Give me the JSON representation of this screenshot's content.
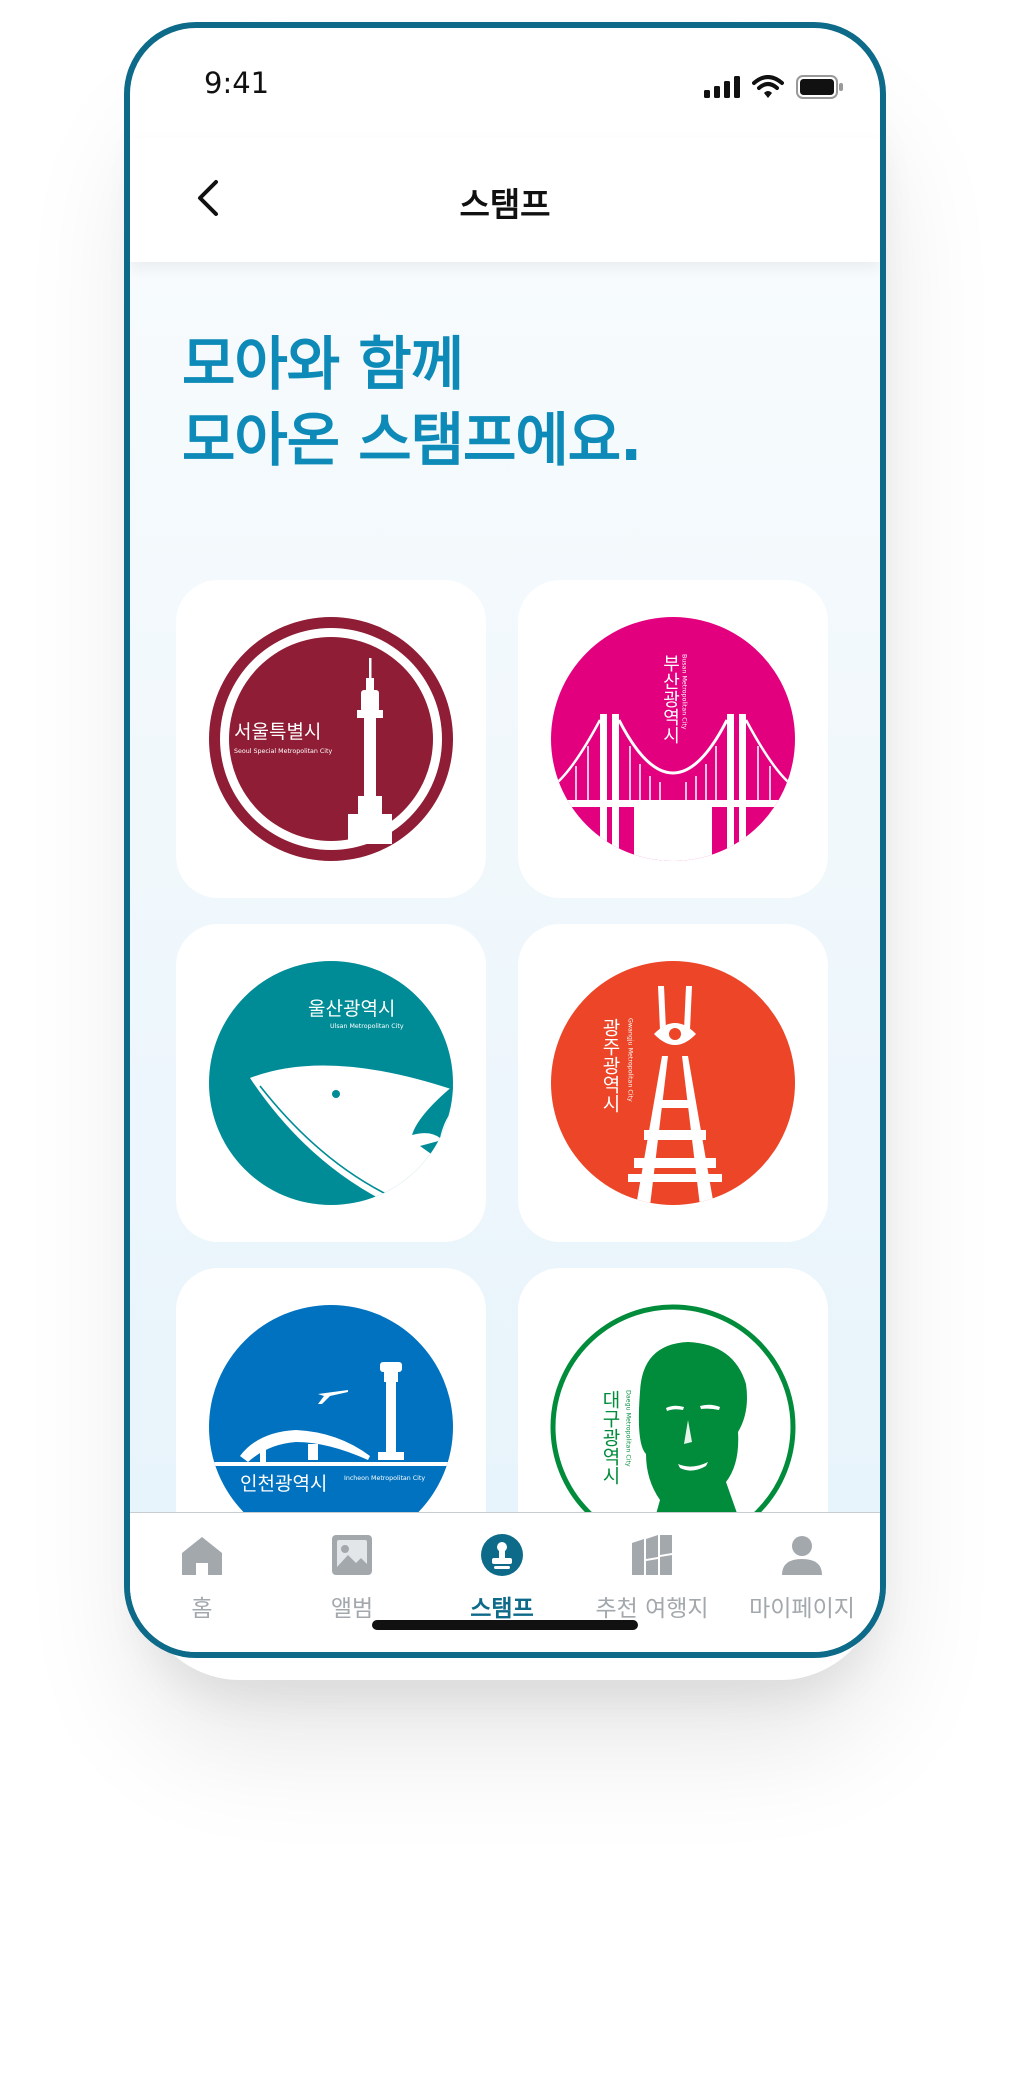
{
  "status_bar": {
    "time": "9:41"
  },
  "header": {
    "title": "스탬프"
  },
  "headline": {
    "line1": "모아와 함께",
    "line2": "모아온 스탬프에요."
  },
  "stamps": [
    {
      "name": "서울특별시",
      "subtitle": "Seoul Special Metropolitan City",
      "color": "#8e1d35"
    },
    {
      "name": "부산광역시",
      "subtitle": "Busan Metropolitan City",
      "color": "#e3007f"
    },
    {
      "name": "울산광역시",
      "subtitle": "Ulsan Metropolitan City",
      "color": "#008c96"
    },
    {
      "name": "광주광역시",
      "subtitle": "Gwangju Metropolitan City",
      "color": "#ec4527"
    },
    {
      "name": "인천광역시",
      "subtitle": "Incheon Metropolitan City",
      "color": "#0072bf"
    },
    {
      "name": "대구광역시",
      "subtitle": "Daegu Metropolitan City",
      "color": "#008c3a"
    }
  ],
  "tabs": [
    {
      "label": "홈",
      "icon": "home-icon"
    },
    {
      "label": "앨범",
      "icon": "album-icon"
    },
    {
      "label": "스탬프",
      "icon": "stamp-icon",
      "active": true
    },
    {
      "label": "추천 여행지",
      "icon": "recommend-icon"
    },
    {
      "label": "마이페이지",
      "icon": "person-icon"
    }
  ],
  "colors": {
    "accent": "#0d6a88",
    "headline": "#0e8ab8",
    "inactive": "#a3a8ad"
  }
}
